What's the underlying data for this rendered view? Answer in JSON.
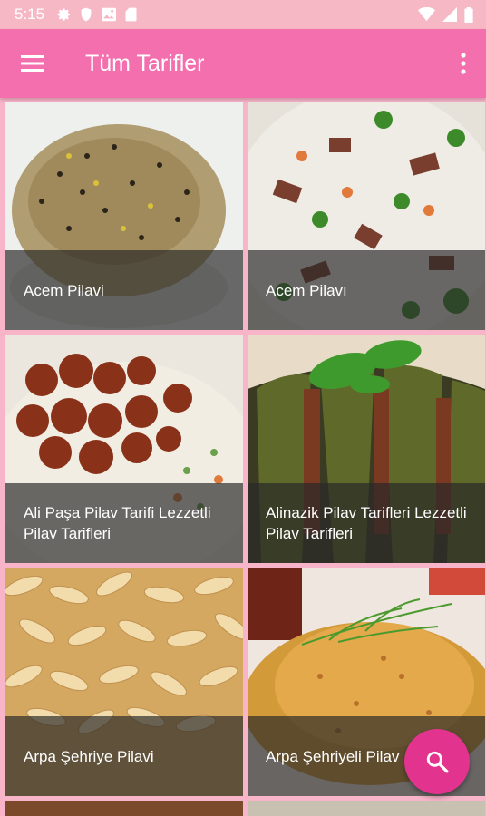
{
  "status_bar": {
    "time": "5:15"
  },
  "app_bar": {
    "title": "Tüm Tarifler"
  },
  "recipes": [
    {
      "title": "Acem Pilavi"
    },
    {
      "title": "Acem Pilavı"
    },
    {
      "title": "Ali Paşa Pilav Tarifi Lezzetli Pilav Tarifleri"
    },
    {
      "title": "Alinazik Pilav Tarifleri Lezzetli Pilav Tarifleri"
    },
    {
      "title": "Arpa Şehriye Pilavi"
    },
    {
      "title": "Arpa Şehriyeli Pilav"
    }
  ],
  "colors": {
    "app_bar": "#f46fae",
    "status_bar": "#f7b8c6",
    "fab": "#e2348e",
    "background": "#f8b4c8"
  },
  "icons": {
    "menu": "hamburger-icon",
    "more": "more-vert-icon",
    "fab": "search-icon"
  }
}
